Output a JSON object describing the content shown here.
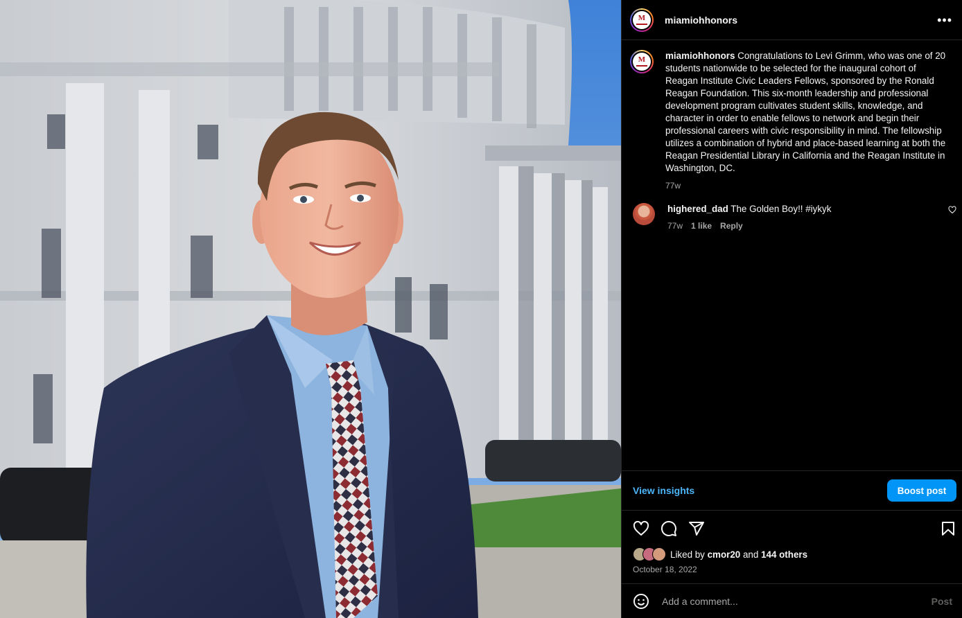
{
  "post": {
    "username": "miamiohhonors",
    "avatar_letter": "M",
    "more_icon": "more-horizontal-icon"
  },
  "caption": {
    "username": "miamiohhonors",
    "text": "Congratulations to Levi Grimm, who was one of 20 students nationwide to be selected for the inaugural cohort of Reagan Institute Civic Leaders Fellows, sponsored by the Ronald Reagan Foundation. This six-month leadership and professional development program cultivates student skills, knowledge, and character in order to enable fellows to network and begin their professional careers with civic responsibility in mind. The fellowship utilizes a combination of hybrid and place-based learning at both the Reagan Presidential Library in California and the Reagan Institute in Washington, DC.",
    "time": "77w"
  },
  "comment": {
    "username": "highered_dad",
    "text": "The Golden Boy!! #iykyk",
    "time": "77w",
    "likes": "1 like",
    "reply": "Reply"
  },
  "insights": {
    "view_label": "View insights",
    "boost_label": "Boost post"
  },
  "likes": {
    "prefix": "Liked by",
    "user": "cmor20",
    "middle": "and",
    "others": "144 others"
  },
  "date": "October 18, 2022",
  "add_comment": {
    "placeholder": "Add a comment...",
    "post_label": "Post"
  },
  "colors": {
    "link_blue": "#4cb5f9",
    "button_blue": "#0095f6",
    "muted": "#a8a8a8"
  }
}
